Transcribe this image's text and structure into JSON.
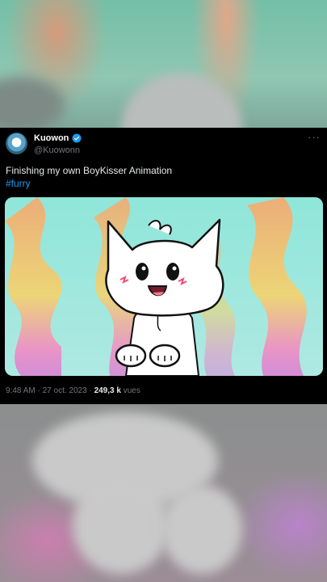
{
  "tweet": {
    "display_name": "Kuowon",
    "handle": "@Kuowonn",
    "text": "Finishing my own BoyKisser Animation",
    "hashtag": "#furry",
    "time": "9:48 AM",
    "date": "27 oct. 2023",
    "views_count": "249,3 k",
    "views_label": "vues",
    "separator": "·"
  },
  "icons": {
    "more": "more-options-icon",
    "verified": "verified-badge-icon"
  },
  "colors": {
    "accent": "#1d9bf0",
    "background": "#000000",
    "muted": "#71767b"
  }
}
